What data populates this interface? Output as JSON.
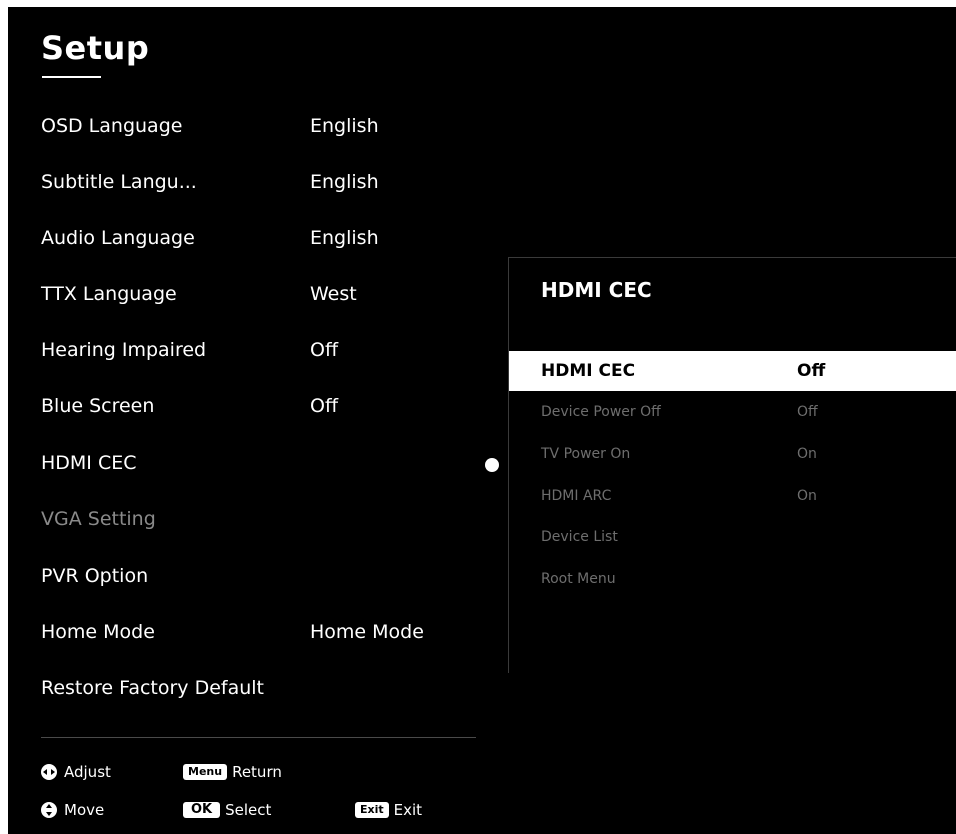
{
  "setup": {
    "title": "Setup",
    "items": [
      {
        "label": "OSD Language",
        "value": "English"
      },
      {
        "label": "Subtitle Langu...",
        "value": "English"
      },
      {
        "label": "Audio Language",
        "value": "English"
      },
      {
        "label": "TTX  Language",
        "value": "West"
      },
      {
        "label": "Hearing Impaired",
        "value": "Off"
      },
      {
        "label": "Blue Screen",
        "value": "Off"
      },
      {
        "label": "HDMI CEC",
        "value": ""
      },
      {
        "label": "VGA Setting",
        "value": "",
        "disabled": true
      },
      {
        "label": "PVR  Option",
        "value": ""
      },
      {
        "label": "Home Mode",
        "value": "Home Mode"
      },
      {
        "label": "Restore Factory Default",
        "value": ""
      }
    ]
  },
  "submenu": {
    "title": "HDMI CEC",
    "items": [
      {
        "label": "HDMI CEC",
        "value": "Off",
        "selected": true
      },
      {
        "label": "Device Power Off",
        "value": "Off"
      },
      {
        "label": "TV Power On",
        "value": "On"
      },
      {
        "label": "HDMI ARC",
        "value": "On"
      },
      {
        "label": "Device List",
        "value": ""
      },
      {
        "label": "Root Menu",
        "value": ""
      }
    ]
  },
  "hints": {
    "adjust": "Adjust",
    "menu_key": "Menu",
    "return": "Return",
    "move": "Move",
    "ok_key": "OK",
    "select": "Select",
    "exit_key": "Exit",
    "exit": "Exit"
  },
  "colors": {
    "background": "#000000",
    "text": "#ffffff",
    "disabled_text": "#8a8a8a",
    "selected_row": "#ffffff"
  }
}
